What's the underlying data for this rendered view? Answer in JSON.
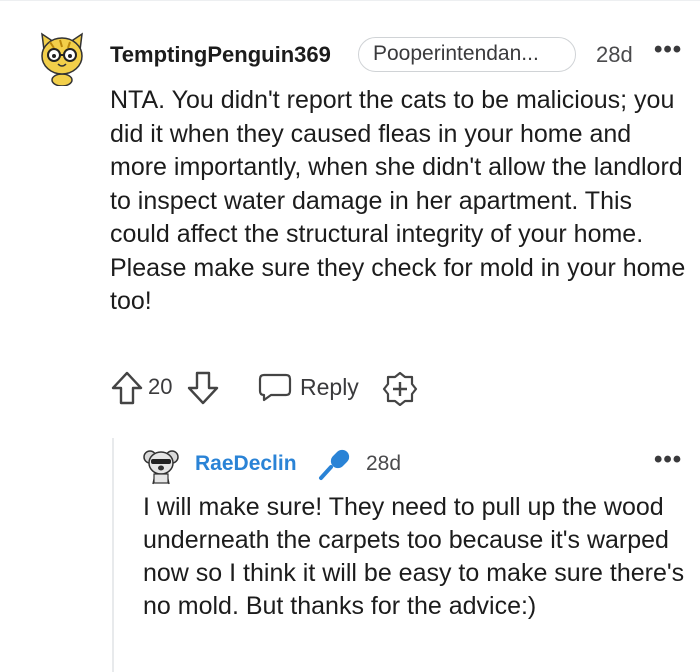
{
  "comment": {
    "author": "TemptingPenguin369",
    "flair": "Pooperintendan...",
    "age": "28d",
    "more": "•••",
    "body": "NTA. You didn't report the cats to be malicious; you did it when they caused fleas in your home and more importantly, when she didn't allow the landlord to inspect water damage in her apartment. This could affect the structural integrity of your home. Please make sure they check for mold in your home too!",
    "vote_count": "20",
    "reply_label": "Reply"
  },
  "reply": {
    "author": "RaeDeclin",
    "age": "28d",
    "more": "•••",
    "body": "I will make sure! They need to pull up the wood underneath the carpets too because it's warped now so I think it will be easy to make sure there's no mold. But thanks for the advice:)"
  },
  "colors": {
    "reply_author": "#2a83d6",
    "mic_badge": "#2a83d6",
    "avatar1_fur": "#f2cf4a"
  },
  "icons": {
    "upvote": "arrow-up-icon",
    "downvote": "arrow-down-icon",
    "reply": "speech-bubble-icon",
    "award": "plus-award-icon",
    "badge": "microphone-icon"
  }
}
